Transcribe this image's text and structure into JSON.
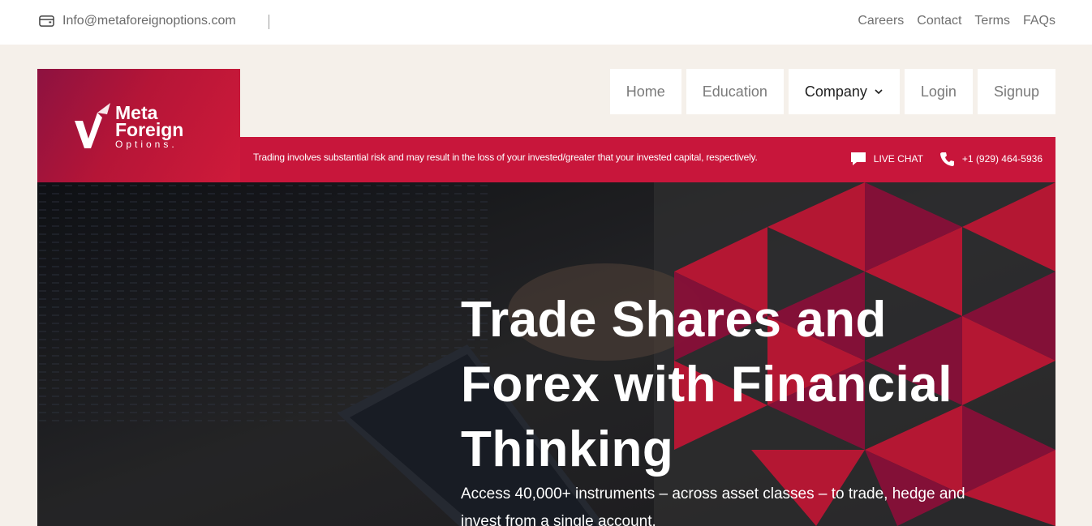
{
  "topbar": {
    "email": "Info@metaforeignoptions.com",
    "links": [
      "Careers",
      "Contact",
      "Terms",
      "FAQs"
    ]
  },
  "logo": {
    "line1": "Meta",
    "line2": "Foreign",
    "line3": "Options."
  },
  "nav": {
    "items": [
      {
        "label": "Home"
      },
      {
        "label": "Education"
      },
      {
        "label": "Company",
        "icon": "chevron-down-icon"
      },
      {
        "label": "Login"
      },
      {
        "label": "Signup"
      }
    ]
  },
  "riskbar": {
    "disclaimer": "Trading involves substantial risk and may result in the loss of your invested/greater that your invested capital, respectively.",
    "live_chat": "LIVE CHAT",
    "phone": "+1 (929) 464-5936"
  },
  "hero": {
    "title": "Trade Shares and Forex with Financial Thinking",
    "subtitle": "Access 40,000+ instruments – across asset classes – to trade, hedge and invest from a single account."
  },
  "colors": {
    "brand_red": "#c8163b",
    "brand_dark": "#8d1240",
    "background": "#f5f0ea"
  }
}
